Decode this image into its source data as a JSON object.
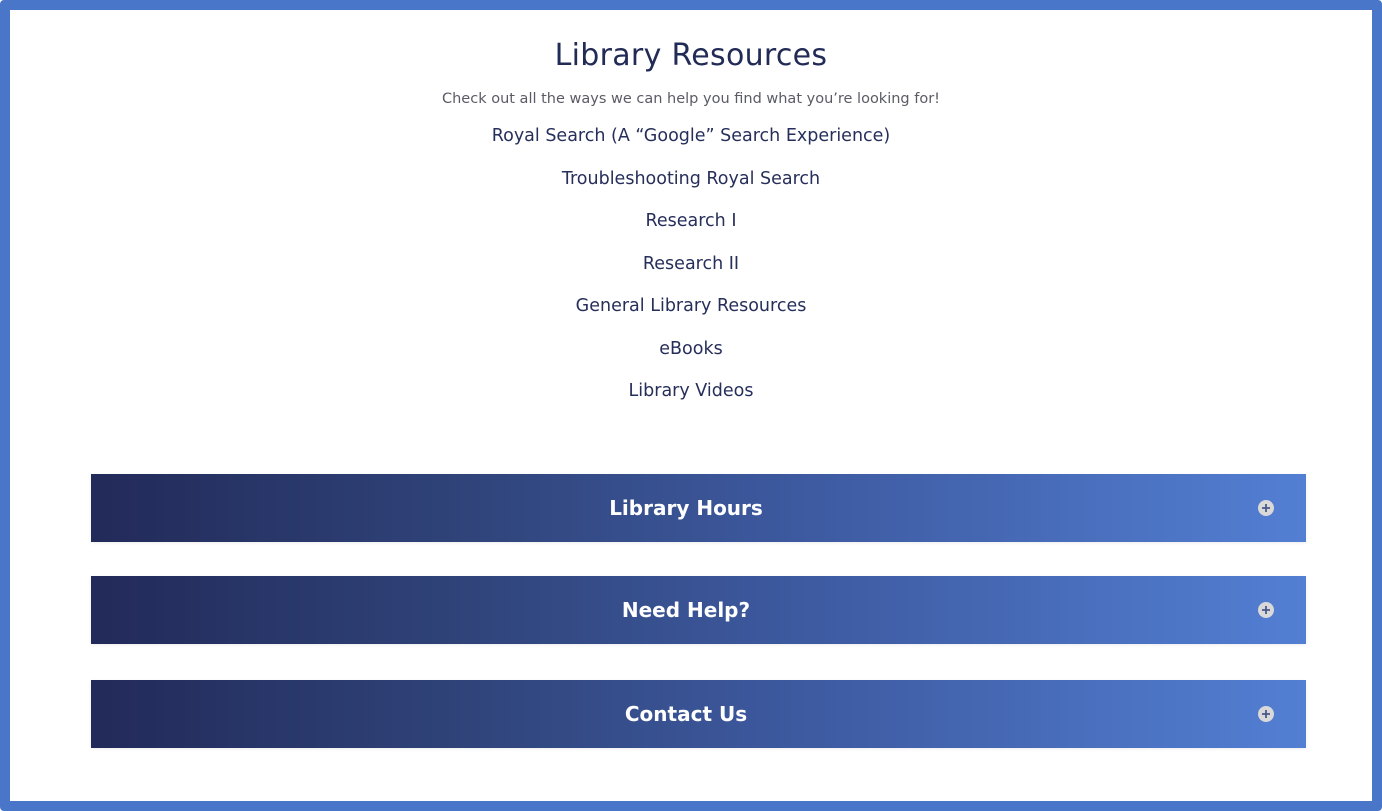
{
  "page": {
    "title": "Library Resources",
    "subtitle": "Check out all the ways we can help you find what you’re looking for!"
  },
  "links": [
    {
      "label": "Royal Search (A “Google” Search Experience)"
    },
    {
      "label": "Troubleshooting Royal Search"
    },
    {
      "label": "Research I"
    },
    {
      "label": "Research II"
    },
    {
      "label": "General Library Resources"
    },
    {
      "label": "eBooks"
    },
    {
      "label": "Library Videos"
    }
  ],
  "accordions": [
    {
      "label": "Library Hours",
      "icon": "plus-circle-icon"
    },
    {
      "label": "Need Help?",
      "icon": "plus-circle-icon"
    },
    {
      "label": "Contact Us",
      "icon": "plus-circle-icon"
    }
  ],
  "colors": {
    "frame_border": "#4a76c9",
    "heading": "#212b56",
    "accordion_gradient_start": "#222a59",
    "accordion_gradient_end": "#537fd3"
  }
}
